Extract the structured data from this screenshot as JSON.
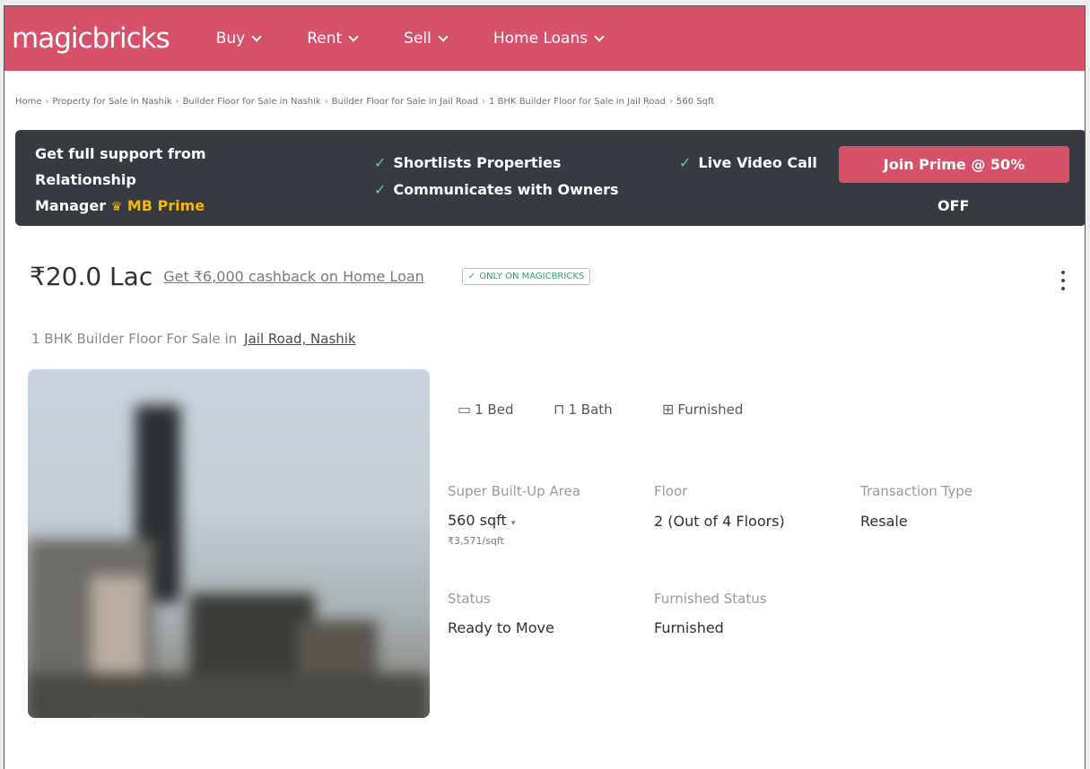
{
  "brand": {
    "logo": "magicbricks",
    "accent": "#d8516a",
    "banner_bg": "#373b41",
    "prime_gold": "#f5b700",
    "tick_green": "#6ccf8d"
  },
  "nav": {
    "items": [
      {
        "label": "Buy"
      },
      {
        "label": "Rent"
      },
      {
        "label": "Sell"
      },
      {
        "label": "Home Loans"
      }
    ]
  },
  "breadcrumb": [
    "Home",
    "Property for Sale in Nashik",
    "Builder Floor for Sale in Nashik",
    "Builder Floor for Sale in Jail Road",
    "1 BHK Builder Floor for Sale in Jail Road",
    "560 Sqft"
  ],
  "prime_banner": {
    "line1": "Get full support from",
    "line2": "Relationship",
    "line3": "Manager",
    "prime_label": "MB Prime",
    "features": [
      "Shortlists Properties",
      "Communicates with Owners",
      "Live Video Call"
    ],
    "cta_label": "Join Prime @ 50%",
    "cta_suffix": "OFF"
  },
  "listing": {
    "price": "₹20.0 Lac",
    "cashback_link": "Get ₹6,000 cashback on Home Loan",
    "exclusive_badge": "ONLY ON MAGICBRICKS",
    "title_prefix": "1 BHK Builder Floor For Sale in",
    "location": "Jail Road, Nashik",
    "amenities": [
      {
        "icon": "bed-icon",
        "label": "1 Bed"
      },
      {
        "icon": "bath-icon",
        "label": "1 Bath"
      },
      {
        "icon": "furnished-icon",
        "label": "Furnished"
      }
    ],
    "details": {
      "area_label": "Super Built-Up Area",
      "area_value": "560 sqft",
      "area_rate": "₹3,571/sqft",
      "floor_label": "Floor",
      "floor_value": "2 (Out of 4 Floors)",
      "transaction_label": "Transaction Type",
      "transaction_value": "Resale",
      "status_label": "Status",
      "status_value": "Ready to Move",
      "furnished_label": "Furnished Status",
      "furnished_value": "Furnished"
    }
  }
}
